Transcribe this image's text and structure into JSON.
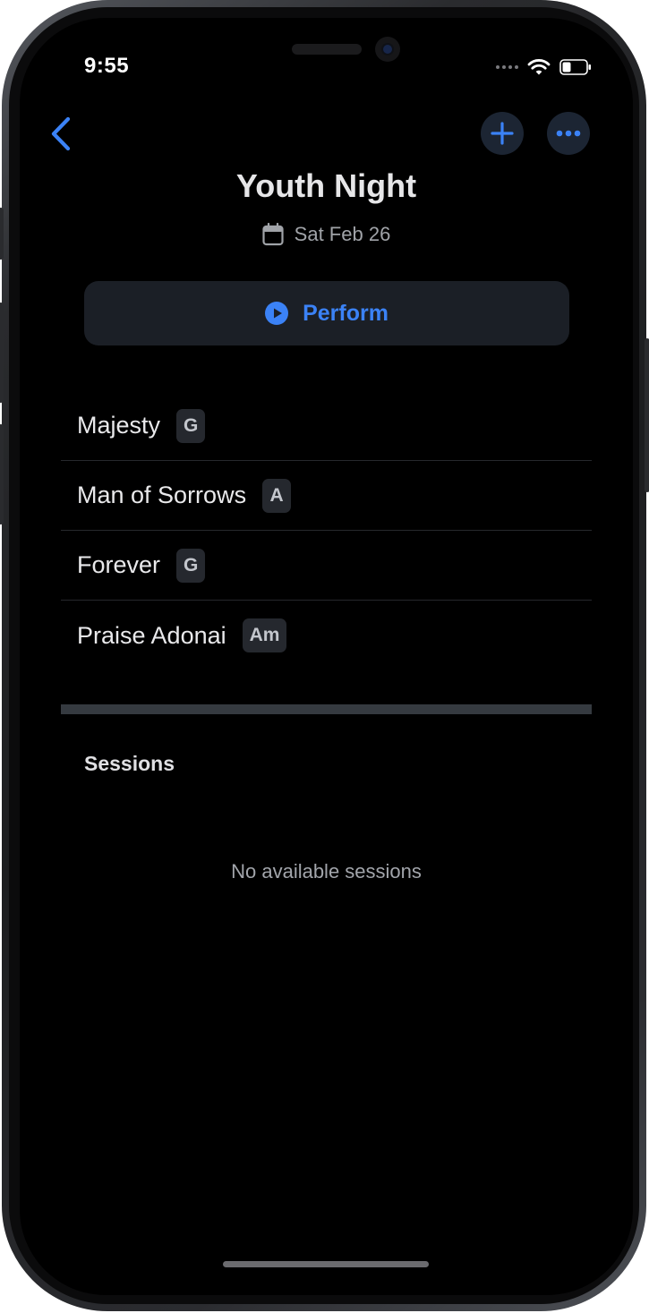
{
  "status_bar": {
    "time": "9:55"
  },
  "nav": {
    "back_icon": "chevron-left-icon",
    "add_icon": "plus-icon",
    "more_icon": "ellipsis-icon",
    "accent_color": "#3b82f6"
  },
  "header": {
    "title": "Youth Night",
    "date": "Sat Feb 26",
    "date_icon": "calendar-icon"
  },
  "perform_button": {
    "label": "Perform",
    "icon": "play-circle-icon"
  },
  "songs": [
    {
      "title": "Majesty",
      "key": "G"
    },
    {
      "title": "Man of Sorrows",
      "key": "A"
    },
    {
      "title": "Forever",
      "key": "G"
    },
    {
      "title": "Praise Adonai",
      "key": "Am"
    }
  ],
  "sessions": {
    "header": "Sessions",
    "empty_message": "No available sessions"
  }
}
